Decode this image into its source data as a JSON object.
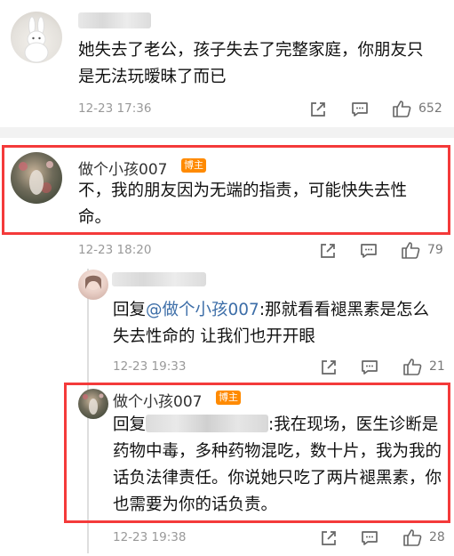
{
  "comments": [
    {
      "text": "她失去了老公，孩子失去了完整家庭，你朋友只是无法玩暧昧了而已",
      "time": "12-23 17:36",
      "likes": "652"
    },
    {
      "name": "做个小孩007",
      "badge": "博主",
      "text": "不，我的朋友因为无端的指责，可能快失去性命。",
      "time": "12-23 18:20",
      "likes": "79"
    },
    {
      "reply_prefix": "回复",
      "mention": "@做个小孩007",
      "text_rest": ":那就看看褪黑素是怎么失去性命的 让我们也开开眼",
      "time": "12-23 19:33",
      "likes": "21"
    },
    {
      "name": "做个小孩007",
      "badge": "博主",
      "reply_prefix": "回复",
      "text_rest": ":我在现场，医生诊断是药物中毒，多种药物混吃，数十片，我为我的话负法律责任。你说她只吃了两片褪黑素，你也需要为你的话负责。",
      "time": "12-23 19:38",
      "likes": "28"
    }
  ],
  "icons": {
    "share": "share-icon",
    "comment": "comment-icon",
    "like": "thumbs-up-icon"
  },
  "colors": {
    "highlight_border": "#f43a3a",
    "badge": "#ff8a00",
    "mention": "#3d6ea8"
  }
}
